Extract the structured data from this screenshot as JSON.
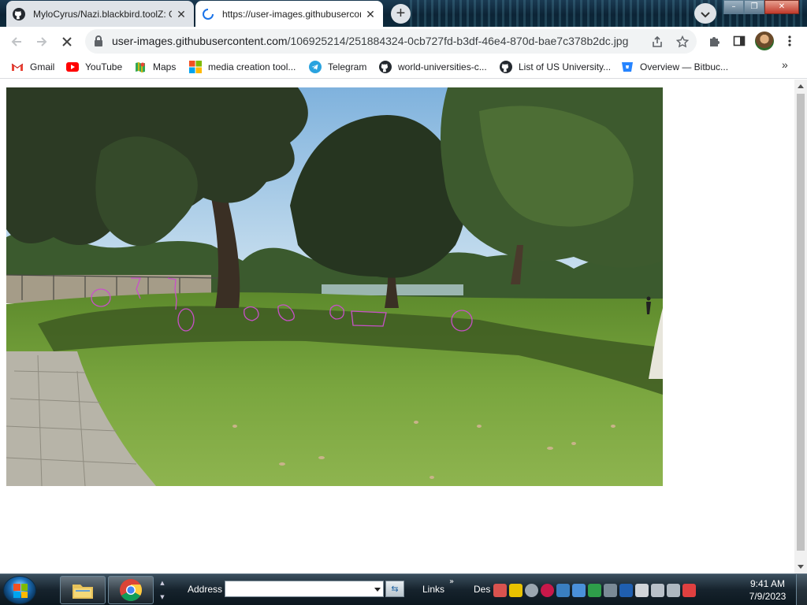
{
  "tabs": [
    {
      "title": "MyloCyrus/Nazi.blackbird.toolZ: Gith",
      "icon": "github-icon",
      "active": false
    },
    {
      "title": "https://user-images.githubuserconten",
      "icon": "loading-spinner-icon",
      "active": true
    }
  ],
  "omnibox": {
    "host": "user-images.githubusercontent.com",
    "path": "/106925214/251884324-0cb727fd-b3df-46e4-870d-bae7c378b2dc.jpg"
  },
  "bookmarks": [
    {
      "label": "Gmail",
      "icon": "gmail-icon"
    },
    {
      "label": "YouTube",
      "icon": "youtube-icon"
    },
    {
      "label": "Maps",
      "icon": "maps-icon"
    },
    {
      "label": "media creation tool...",
      "icon": "microsoft-icon"
    },
    {
      "label": "Telegram",
      "icon": "telegram-icon"
    },
    {
      "label": "world-universities-c...",
      "icon": "github-icon"
    },
    {
      "label": "List of US University...",
      "icon": "github-icon"
    },
    {
      "label": "Overview — Bitbuc...",
      "icon": "bitbucket-icon"
    }
  ],
  "bookmarks_more": "»",
  "taskbar": {
    "address_label": "Address",
    "address_value": "",
    "links_label": "Links",
    "links_more": "»",
    "desktop_label": "Des",
    "time": "9:41 AM",
    "date": "7/9/2023"
  },
  "photo": {
    "description_icon": "park-photo",
    "colors": {
      "sky": "#a9cbe6",
      "grass": "#6f9a3a",
      "shadow": "#3e5a22",
      "trees": "#2c3a24",
      "annotation": "#c850c8"
    }
  }
}
